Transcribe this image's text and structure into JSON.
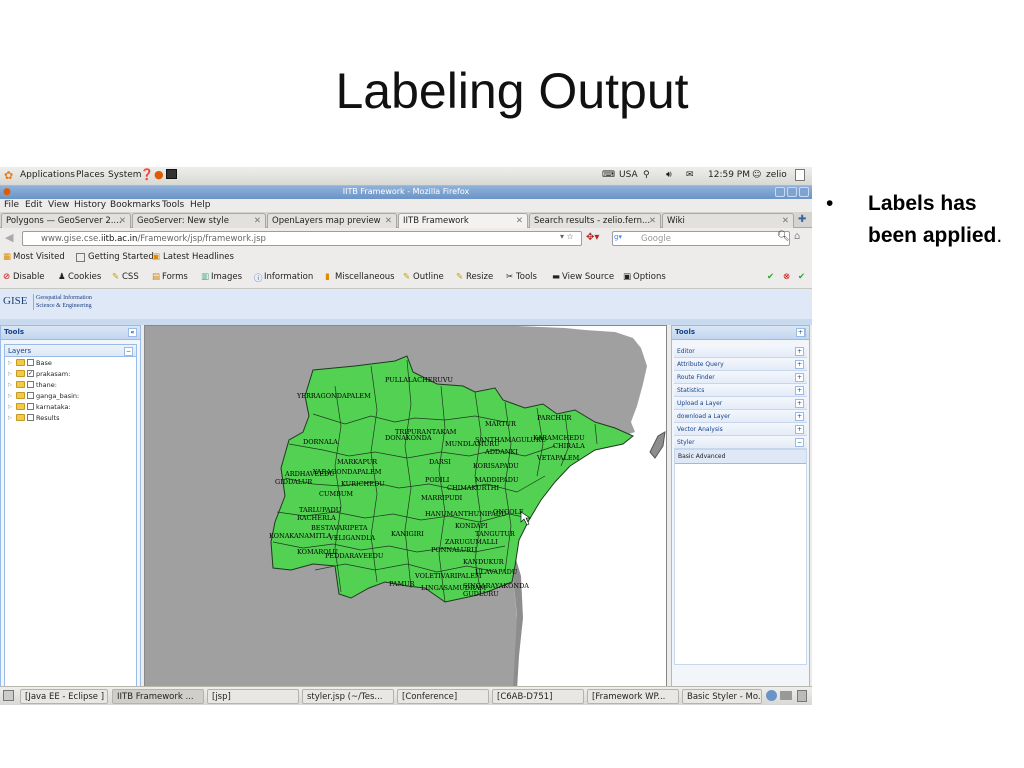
{
  "slide": {
    "title": "Labeling Output",
    "bullet_main": "Labels has been applied",
    "bullet_end": "."
  },
  "gnome": {
    "apps": "Applications",
    "places": "Places",
    "system": "System",
    "keyboard": "USA",
    "clock": "12:59 PM",
    "user": "zelio"
  },
  "window": {
    "title": "IITB Framework - Mozilla Firefox"
  },
  "menu": [
    "File",
    "Edit",
    "View",
    "History",
    "Bookmarks",
    "Tools",
    "Help"
  ],
  "tabs": [
    "Polygons — GeoServer 2....",
    "GeoServer: New style",
    "OpenLayers map preview",
    "IITB Framework",
    "Search results - zelio.fern...",
    "Wiki"
  ],
  "nav": {
    "url_prefix": "www.gise.cse.",
    "url_host": "iitb.ac.in",
    "url_path": "/Framework/jsp/framework.jsp",
    "search_placeholder": "Google"
  },
  "bookmarks": [
    "Most Visited",
    "Getting Started",
    "Latest Headlines"
  ],
  "devtools": [
    "Disable",
    "Cookies",
    "CSS",
    "Forms",
    "Images",
    "Information",
    "Miscellaneous",
    "Outline",
    "Resize",
    "Tools",
    "View Source",
    "Options"
  ],
  "site": {
    "logo": "GISE",
    "logo_line1": "Geospatial Information",
    "logo_line2": "Science & Engineering"
  },
  "left_panel": {
    "title": "Tools",
    "layers_title": "Layers",
    "layers": [
      {
        "name": "Base",
        "checked": false
      },
      {
        "name": "prakasam:",
        "checked": true
      },
      {
        "name": "thane:",
        "checked": false
      },
      {
        "name": "ganga_basin:",
        "checked": false
      },
      {
        "name": "karnataka:",
        "checked": false
      },
      {
        "name": "Results",
        "checked": false
      }
    ]
  },
  "right_panel": {
    "title": "Tools",
    "tools": [
      "Editor",
      "Attribute Query",
      "Route Finder",
      "Statistics",
      "Upload a Layer",
      "download a Layer",
      "Vector Analysis",
      "Styler"
    ],
    "styler_tabs": "Basic   Advanced"
  },
  "map": {
    "fill": "#52d152",
    "labels": [
      "PULLALACHERUVU",
      "YERRAGONDAPALEM",
      "MARTUR",
      "PARCHUR",
      "KARAMCHEDU",
      "CHIRALA",
      "VETAPALEM",
      "DORNALA",
      "TRIPURANTAKAM",
      "DONAKONDA",
      "MUNDLAMURU",
      "SANTHAMAGULURU",
      "ADDANKI",
      "KORISAPADU",
      "MARKAPUR",
      "ARDHAVEEDU",
      "GIDDALUR",
      "YARAGONDAPALEM",
      "PODILI",
      "MADDIPADU",
      "CHIMAKURTHI",
      "DARSI",
      "KURICHEDU",
      "CUMBUM",
      "TARLUPADU",
      "MARRIPUDI",
      "ONGOLE",
      "KOMAROLU",
      "RACHERLA",
      "BESTAVARIPETA",
      "VELIGANDLA",
      "KANIGIRI",
      "HANUMANTHUNIPADU",
      "PAMUR",
      "LINGASAMUDRAM",
      "VOLETIVARIPALEM",
      "KONDAPI",
      "TANGUTUR",
      "ZARUGUMALLI",
      "PONNALURU",
      "KANDUKUR",
      "ULAVAPADU",
      "GUDLURU",
      "SINGARAYAKONDA",
      "KONAKANAMITLA",
      "PEDDARAVEEDU",
      "PULLALACHERUVU"
    ]
  },
  "taskbar": [
    "[Java EE - Eclipse ]",
    "IITB Framework ...",
    "[jsp]",
    "styler.jsp (~/Tes...",
    "[Conference]",
    "[C6AB-D751]",
    "[Framework WP...",
    "Basic Styler - Mo..."
  ]
}
